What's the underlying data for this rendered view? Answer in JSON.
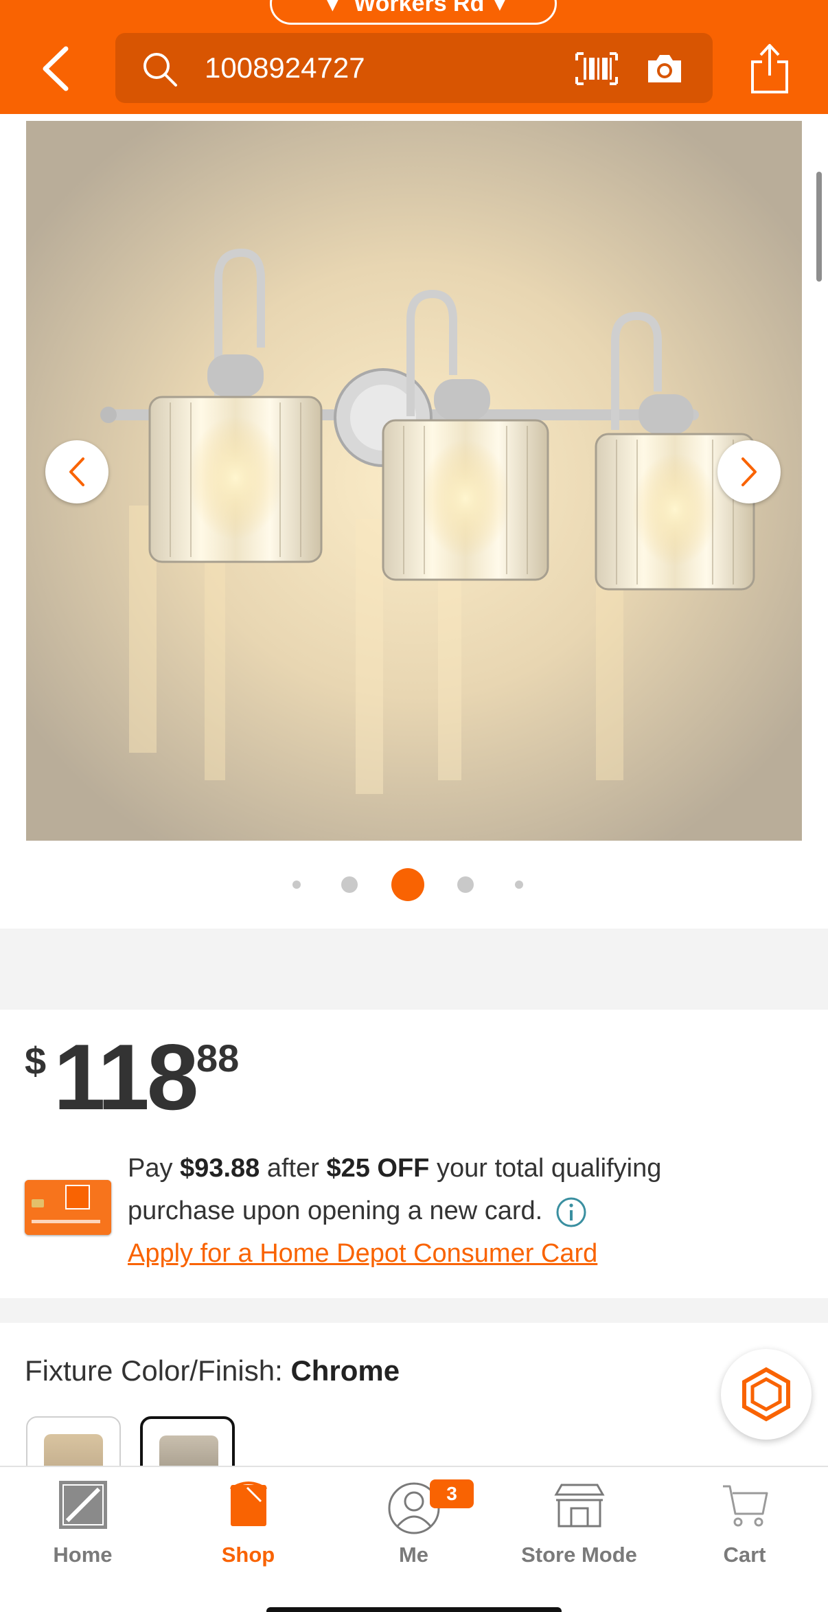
{
  "header": {
    "store_name": "Workers Rd",
    "search_value": "1008924727"
  },
  "gallery": {
    "dot_count": 5,
    "active_dot": 2
  },
  "price": {
    "currency": "$",
    "dollars": "118",
    "cents": "88"
  },
  "offer": {
    "pay_prefix": "Pay",
    "pay_amount": "$93.88",
    "after_text": "after",
    "discount": "$25 OFF",
    "suffix_text": "your total qualifying",
    "line2": "purchase upon opening a new card.",
    "apply_link": "Apply for a Home Depot Consumer Card"
  },
  "fixture": {
    "label": "Fixture Color/Finish:",
    "value": "Chrome"
  },
  "bottom_nav": {
    "items": [
      {
        "label": "Home"
      },
      {
        "label": "Shop"
      },
      {
        "label": "Me"
      },
      {
        "label": "Store Mode"
      },
      {
        "label": "Cart"
      }
    ],
    "me_badge": "3",
    "active": "Shop"
  },
  "colors": {
    "brand_orange": "#f96302",
    "search_bg": "#d85502"
  }
}
